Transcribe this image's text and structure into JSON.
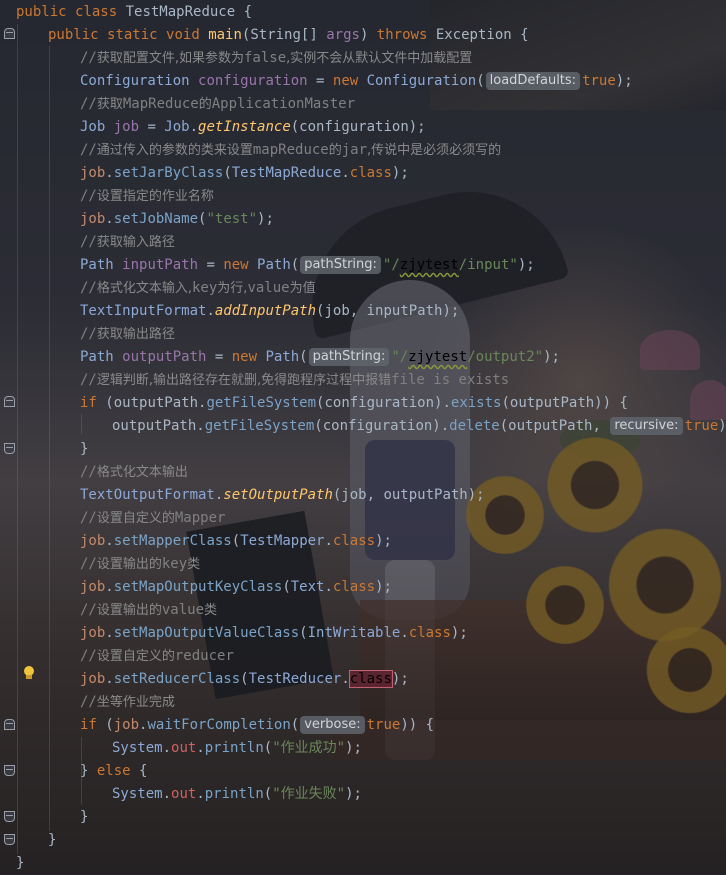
{
  "editor": {
    "lines": [
      {
        "n": 1,
        "indent": 0,
        "tokens": [
          [
            "kw",
            "public "
          ],
          [
            "kw",
            "class "
          ],
          [
            "cls2",
            "TestMapReduce "
          ],
          [
            "txt",
            "{"
          ]
        ]
      },
      {
        "n": 2,
        "indent": 1,
        "tokens": [
          [
            "kw",
            "public "
          ],
          [
            "kw",
            "static "
          ],
          [
            "kw",
            "void "
          ],
          [
            "fn",
            "main"
          ],
          [
            "txt",
            "("
          ],
          [
            "cls2",
            "String"
          ],
          [
            "txt",
            "[] "
          ],
          [
            "var",
            "args"
          ],
          [
            "txt",
            ") "
          ],
          [
            "kw",
            "throws "
          ],
          [
            "cls2",
            "Exception "
          ],
          [
            "txt",
            "{"
          ]
        ]
      },
      {
        "n": 3,
        "indent": 2,
        "tokens": [
          [
            "cm",
            "//"
          ],
          [
            "cmc",
            "获取配置文件,如果参数为"
          ],
          [
            "cm",
            "false"
          ],
          [
            "cmc",
            ",实例不会从默认文件中加载配置"
          ]
        ]
      },
      {
        "n": 4,
        "indent": 2,
        "tokens": [
          [
            "typ",
            "Configuration "
          ],
          [
            "var",
            "configuration "
          ],
          [
            "txt",
            "= "
          ],
          [
            "kw",
            "new "
          ],
          [
            "typ",
            "Configuration"
          ],
          [
            "txt",
            "("
          ],
          [
            "hint",
            "loadDefaults:"
          ],
          [
            "kw",
            "true"
          ],
          [
            "txt",
            ");"
          ]
        ]
      },
      {
        "n": 5,
        "indent": 2,
        "tokens": [
          [
            "cm",
            "//"
          ],
          [
            "cmc",
            "获取"
          ],
          [
            "cm",
            "MapReduce"
          ],
          [
            "cmc",
            "的"
          ],
          [
            "cm",
            "ApplicationMaster"
          ]
        ]
      },
      {
        "n": 6,
        "indent": 2,
        "tokens": [
          [
            "typ",
            "Job "
          ],
          [
            "var",
            "job "
          ],
          [
            "txt",
            "= "
          ],
          [
            "typ",
            "Job"
          ],
          [
            "txt",
            "."
          ],
          [
            "it",
            "getInstance"
          ],
          [
            "txt",
            "(configuration);"
          ]
        ]
      },
      {
        "n": 7,
        "indent": 2,
        "tokens": [
          [
            "cm",
            "//"
          ],
          [
            "cmc",
            "通过传入的参数的类来设置"
          ],
          [
            "cm",
            "mapReduce"
          ],
          [
            "cmc",
            "的"
          ],
          [
            "cm",
            "jar"
          ],
          [
            "cmc",
            ",传说中是必须必须写的"
          ]
        ]
      },
      {
        "n": 8,
        "indent": 2,
        "tokens": [
          [
            "obj",
            "job"
          ],
          [
            "txt",
            "."
          ],
          [
            "mth",
            "setJarByClass"
          ],
          [
            "txt",
            "("
          ],
          [
            "typ",
            "TestMapReduce"
          ],
          [
            "txt",
            "."
          ],
          [
            "kw",
            "class"
          ],
          [
            "txt",
            ");"
          ]
        ]
      },
      {
        "n": 9,
        "indent": 2,
        "tokens": [
          [
            "cm",
            "//"
          ],
          [
            "cmc",
            "设置指定的作业名称"
          ]
        ]
      },
      {
        "n": 10,
        "indent": 2,
        "tokens": [
          [
            "obj",
            "job"
          ],
          [
            "txt",
            "."
          ],
          [
            "mth",
            "setJobName"
          ],
          [
            "txt",
            "("
          ],
          [
            "str",
            "\"test\""
          ],
          [
            "txt",
            ");"
          ]
        ]
      },
      {
        "n": 11,
        "indent": 2,
        "tokens": [
          [
            "cm",
            "//"
          ],
          [
            "cmc",
            "获取输入路径"
          ]
        ]
      },
      {
        "n": 12,
        "indent": 2,
        "tokens": [
          [
            "typ",
            "Path "
          ],
          [
            "var",
            "inputPath "
          ],
          [
            "txt",
            "= "
          ],
          [
            "kw",
            "new "
          ],
          [
            "typ",
            "Path"
          ],
          [
            "txt",
            "("
          ],
          [
            "hint",
            "pathString:"
          ],
          [
            "str",
            "\"/"
          ],
          [
            "squig",
            "zjytest"
          ],
          [
            "str",
            "/input\""
          ],
          [
            "txt",
            ");"
          ]
        ]
      },
      {
        "n": 13,
        "indent": 2,
        "tokens": [
          [
            "cm",
            "//"
          ],
          [
            "cmc",
            "格式化文本输入,"
          ],
          [
            "cm",
            "key"
          ],
          [
            "cmc",
            "为行,"
          ],
          [
            "cm",
            "value"
          ],
          [
            "cmc",
            "为值"
          ]
        ]
      },
      {
        "n": 14,
        "indent": 2,
        "tokens": [
          [
            "typ",
            "TextInputFormat"
          ],
          [
            "txt",
            "."
          ],
          [
            "it",
            "addInputPath"
          ],
          [
            "txt",
            "(job, inputPath);"
          ]
        ]
      },
      {
        "n": 15,
        "indent": 2,
        "tokens": [
          [
            "cm",
            "//"
          ],
          [
            "cmc",
            "获取输出路径"
          ]
        ]
      },
      {
        "n": 16,
        "indent": 2,
        "tokens": [
          [
            "typ",
            "Path "
          ],
          [
            "var",
            "outputPath "
          ],
          [
            "txt",
            "= "
          ],
          [
            "kw",
            "new "
          ],
          [
            "typ",
            "Path"
          ],
          [
            "txt",
            "("
          ],
          [
            "hint",
            "pathString:"
          ],
          [
            "str",
            "\"/"
          ],
          [
            "squig",
            "zjytest"
          ],
          [
            "str",
            "/output2\""
          ],
          [
            "txt",
            ");"
          ]
        ]
      },
      {
        "n": 17,
        "indent": 2,
        "tokens": [
          [
            "cm",
            "//"
          ],
          [
            "cmc",
            "逻辑判断,输出路径存在就删,免得跑程序过程中报错"
          ],
          [
            "cm",
            "file is exists"
          ]
        ]
      },
      {
        "n": 18,
        "indent": 2,
        "tokens": [
          [
            "kw",
            "if "
          ],
          [
            "txt",
            "(outputPath."
          ],
          [
            "mth",
            "getFileSystem"
          ],
          [
            "txt",
            "(configuration)."
          ],
          [
            "mth",
            "exists"
          ],
          [
            "txt",
            "(outputPath)) {"
          ]
        ]
      },
      {
        "n": 19,
        "indent": 3,
        "tokens": [
          [
            "txt",
            "outputPath."
          ],
          [
            "mth",
            "getFileSystem"
          ],
          [
            "txt",
            "(configuration)."
          ],
          [
            "mth",
            "delete"
          ],
          [
            "txt",
            "(outputPath, "
          ],
          [
            "hint",
            "recursive:"
          ],
          [
            "kw",
            "true"
          ],
          [
            "txt",
            ");"
          ]
        ]
      },
      {
        "n": 20,
        "indent": 2,
        "tokens": [
          [
            "txt",
            "}"
          ]
        ]
      },
      {
        "n": 21,
        "indent": 2,
        "tokens": [
          [
            "cm",
            "//"
          ],
          [
            "cmc",
            "格式化文本输出"
          ]
        ]
      },
      {
        "n": 22,
        "indent": 2,
        "tokens": [
          [
            "typ",
            "TextOutputFormat"
          ],
          [
            "txt",
            "."
          ],
          [
            "it",
            "setOutputPath"
          ],
          [
            "txt",
            "(job, outputPath);"
          ]
        ]
      },
      {
        "n": 23,
        "indent": 2,
        "tokens": [
          [
            "cm",
            "//"
          ],
          [
            "cmc",
            "设置自定义的"
          ],
          [
            "cm",
            "Mapper"
          ]
        ]
      },
      {
        "n": 24,
        "indent": 2,
        "tokens": [
          [
            "obj",
            "job"
          ],
          [
            "txt",
            "."
          ],
          [
            "mth",
            "setMapperClass"
          ],
          [
            "txt",
            "("
          ],
          [
            "typ",
            "TestMapper"
          ],
          [
            "txt",
            "."
          ],
          [
            "kw",
            "class"
          ],
          [
            "txt",
            ");"
          ]
        ]
      },
      {
        "n": 25,
        "indent": 2,
        "tokens": [
          [
            "cm",
            "//"
          ],
          [
            "cmc",
            "设置输出的"
          ],
          [
            "cm",
            "key"
          ],
          [
            "cmc",
            "类"
          ]
        ]
      },
      {
        "n": 26,
        "indent": 2,
        "tokens": [
          [
            "obj",
            "job"
          ],
          [
            "txt",
            "."
          ],
          [
            "mth",
            "setMapOutputKeyClass"
          ],
          [
            "txt",
            "("
          ],
          [
            "typ",
            "Text"
          ],
          [
            "txt",
            "."
          ],
          [
            "kw",
            "class"
          ],
          [
            "txt",
            ");"
          ]
        ]
      },
      {
        "n": 27,
        "indent": 2,
        "tokens": [
          [
            "cm",
            "//"
          ],
          [
            "cmc",
            "设置输出的"
          ],
          [
            "cm",
            "value"
          ],
          [
            "cmc",
            "类"
          ]
        ]
      },
      {
        "n": 28,
        "indent": 2,
        "tokens": [
          [
            "obj",
            "job"
          ],
          [
            "txt",
            "."
          ],
          [
            "mth",
            "setMapOutputValueClass"
          ],
          [
            "txt",
            "("
          ],
          [
            "typ",
            "IntWritable"
          ],
          [
            "txt",
            "."
          ],
          [
            "kw",
            "class"
          ],
          [
            "txt",
            ");"
          ]
        ]
      },
      {
        "n": 29,
        "indent": 2,
        "tokens": [
          [
            "cm",
            "//"
          ],
          [
            "cmc",
            "设置自定义的"
          ],
          [
            "cm",
            "reducer"
          ]
        ]
      },
      {
        "n": 30,
        "indent": 2,
        "tokens": [
          [
            "obj",
            "job"
          ],
          [
            "txt",
            "."
          ],
          [
            "mth",
            "setReducerClass"
          ],
          [
            "txt",
            "("
          ],
          [
            "typ",
            "TestReducer"
          ],
          [
            "txt",
            "."
          ],
          [
            "hl",
            "class"
          ],
          [
            "txt",
            ");"
          ]
        ]
      },
      {
        "n": 31,
        "indent": 2,
        "tokens": [
          [
            "cm",
            "//"
          ],
          [
            "cmc",
            "坐等作业完成"
          ]
        ]
      },
      {
        "n": 32,
        "indent": 2,
        "tokens": [
          [
            "kw",
            "if "
          ],
          [
            "txt",
            "("
          ],
          [
            "obj",
            "job"
          ],
          [
            "txt",
            "."
          ],
          [
            "mth",
            "waitForCompletion"
          ],
          [
            "txt",
            "("
          ],
          [
            "hint",
            "verbose:"
          ],
          [
            "kw",
            "true"
          ],
          [
            "txt",
            ")) {"
          ]
        ]
      },
      {
        "n": 33,
        "indent": 3,
        "tokens": [
          [
            "typ",
            "System"
          ],
          [
            "txt",
            "."
          ],
          [
            "red",
            "out"
          ],
          [
            "txt",
            "."
          ],
          [
            "mth",
            "println"
          ],
          [
            "txt",
            "("
          ],
          [
            "str",
            "\"作业成功\""
          ],
          [
            "txt",
            ");"
          ]
        ]
      },
      {
        "n": 34,
        "indent": 2,
        "tokens": [
          [
            "txt",
            "} "
          ],
          [
            "kw",
            "else "
          ],
          [
            "txt",
            "{"
          ]
        ]
      },
      {
        "n": 35,
        "indent": 3,
        "tokens": [
          [
            "typ",
            "System"
          ],
          [
            "txt",
            "."
          ],
          [
            "red",
            "out"
          ],
          [
            "txt",
            "."
          ],
          [
            "mth",
            "println"
          ],
          [
            "txt",
            "("
          ],
          [
            "str",
            "\"作业失败\""
          ],
          [
            "txt",
            ");"
          ]
        ]
      },
      {
        "n": 36,
        "indent": 2,
        "tokens": [
          [
            "txt",
            "}"
          ]
        ]
      },
      {
        "n": 37,
        "indent": 1,
        "tokens": [
          [
            "txt",
            "}"
          ]
        ]
      },
      {
        "n": 38,
        "indent": 0,
        "tokens": [
          [
            "txt",
            "}"
          ]
        ]
      }
    ]
  },
  "icons": {
    "intention": "lightbulb-icon",
    "fold": "fold-toggle-icon"
  },
  "colors": {
    "keyword": "#cc7832",
    "string": "#6a8759",
    "comment": "#808080",
    "method": "#ffc66d",
    "field": "#9876aa"
  }
}
